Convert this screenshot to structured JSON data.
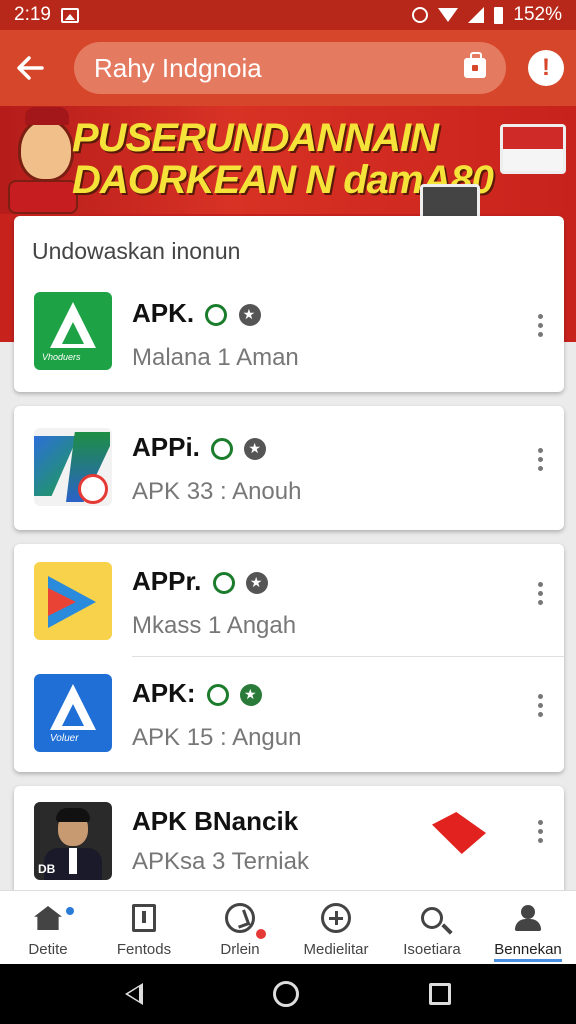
{
  "status_bar": {
    "time": "2:19",
    "battery": "152%"
  },
  "app_bar": {
    "search_text": "Rahy Indgnoia",
    "colors": {
      "bar": "#d6462b",
      "status": "#b8281a"
    }
  },
  "banner": {
    "line1": "PUSERUNDANNAIN",
    "line2": "DAORKEAN N damA80"
  },
  "section": {
    "title": "Undowaskan  inonun"
  },
  "apps": [
    {
      "name": "APK.",
      "meta": "Malana   1   Aman",
      "icon": "green-triangle-icon"
    },
    {
      "name": "APPi.",
      "meta": "APK 33   :   Anouh",
      "icon": "z-logo-icon"
    },
    {
      "name": "APPr.",
      "meta": "Mkass   1   Angah",
      "icon": "play-logo-icon"
    },
    {
      "name": "APK:",
      "meta": "APK 15   :   Angun",
      "icon": "blue-triangle-icon"
    },
    {
      "name": "APK BNancik",
      "meta": "APKsa   3  Terniak",
      "icon": "person-photo-icon"
    }
  ],
  "icon_captions": {
    "green": "Vhoduers",
    "blue": "Voluer",
    "person": "DB"
  },
  "bottom_nav": [
    {
      "label": "Detite",
      "icon": "home-icon"
    },
    {
      "label": "Fentods",
      "icon": "list-icon"
    },
    {
      "label": "Drlein",
      "icon": "clock-icon"
    },
    {
      "label": "Medielitar",
      "icon": "plus-circle-icon"
    },
    {
      "label": "Isoetiara",
      "icon": "search-icon"
    },
    {
      "label": "Bennekan",
      "icon": "people-icon"
    }
  ]
}
